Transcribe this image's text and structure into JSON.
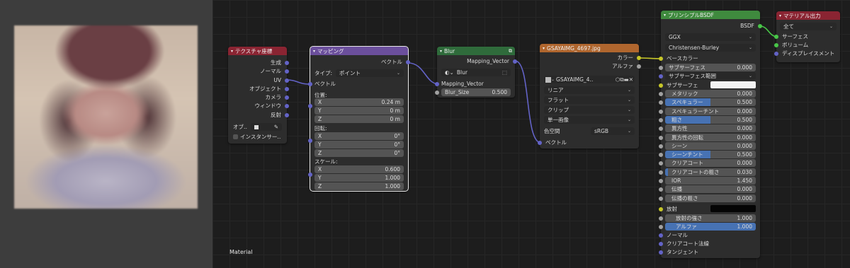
{
  "editor": {
    "label": "Material"
  },
  "tex_coord": {
    "title": "テクスチャ座標",
    "outputs": [
      "生成",
      "ノーマル",
      "UV",
      "オブジェクト",
      "カメラ",
      "ウィンドウ",
      "反射"
    ],
    "object_label": "オブ‥",
    "instancer_label": "インスタンサー‥"
  },
  "mapping": {
    "title": "マッピング",
    "output": "ベクトル",
    "type_label": "タイプ:",
    "type_value": "ポイント",
    "vector_input": "ベクトル",
    "location_label": "位置:",
    "location": [
      {
        "axis": "X",
        "value": "0.24 m"
      },
      {
        "axis": "Y",
        "value": "0 m"
      },
      {
        "axis": "Z",
        "value": "0 m"
      }
    ],
    "rotation_label": "回転:",
    "rotation": [
      {
        "axis": "X",
        "value": "0°"
      },
      {
        "axis": "Y",
        "value": "0°"
      },
      {
        "axis": "Z",
        "value": "0°"
      }
    ],
    "scale_label": "スケール:",
    "scale": [
      {
        "axis": "X",
        "value": "0.600"
      },
      {
        "axis": "Y",
        "value": "1.000"
      },
      {
        "axis": "Z",
        "value": "1.000"
      }
    ]
  },
  "blur": {
    "title": "Blur",
    "output": "Mapping_Vector",
    "group_name": "Blur",
    "input_vector": "Mapping_Vector",
    "blur_size_label": "Blur_Size",
    "blur_size_value": "0.500"
  },
  "image_tex": {
    "title": "GSAYAIMG_4697.jpg",
    "out_color": "カラー",
    "out_alpha": "アルファ",
    "image_name": "GSAYAIMG_4‥",
    "interpolation": "リニア",
    "projection": "フラット",
    "extension": "クリップ",
    "source": "単一画像",
    "colorspace_label": "色空間",
    "colorspace_value": "sRGB",
    "vector_input": "ベクトル"
  },
  "bsdf": {
    "title": "プリンシプルBSDF",
    "output": "BSDF",
    "distribution": "GGX",
    "subsurface_method": "Christensen-Burley",
    "base_color": "ベースカラー",
    "subsurface": {
      "label": "サブサーフェス",
      "value": "0.000"
    },
    "subsurface_radius": "サブサーフェス範囲",
    "subsurface_color": "サブサーフェ",
    "params": [
      {
        "label": "メタリック",
        "value": "0.000",
        "fill": 0
      },
      {
        "label": "スペキュラー",
        "value": "0.500",
        "fill": 50
      },
      {
        "label": "スペキュラーチント",
        "value": "0.000",
        "fill": 0
      },
      {
        "label": "粗さ",
        "value": "0.500",
        "fill": 50
      },
      {
        "label": "異方性",
        "value": "0.000",
        "fill": 0
      },
      {
        "label": "異方性の回転",
        "value": "0.000",
        "fill": 0
      },
      {
        "label": "シーン",
        "value": "0.000",
        "fill": 0
      },
      {
        "label": "シーンチント",
        "value": "0.500",
        "fill": 50
      },
      {
        "label": "クリアコート",
        "value": "0.000",
        "fill": 0
      },
      {
        "label": "クリアコートの粗さ",
        "value": "0.030",
        "fill": 3
      },
      {
        "label": "IOR",
        "value": "1.450",
        "fill": 0
      },
      {
        "label": "伝播",
        "value": "0.000",
        "fill": 0
      },
      {
        "label": "伝播の粗さ",
        "value": "0.000",
        "fill": 0
      }
    ],
    "emission": "放射",
    "emission_strength": {
      "label": "放射の強さ",
      "value": "1.000"
    },
    "alpha": {
      "label": "アルファ",
      "value": "1.000"
    },
    "normal": "ノーマル",
    "clearcoat_normal": "クリアコート法線",
    "tangent": "タンジェント"
  },
  "output": {
    "title": "マテリアル出力",
    "target": "全て",
    "inputs": [
      "サーフェス",
      "ボリューム",
      "ディスプレイスメント"
    ]
  }
}
